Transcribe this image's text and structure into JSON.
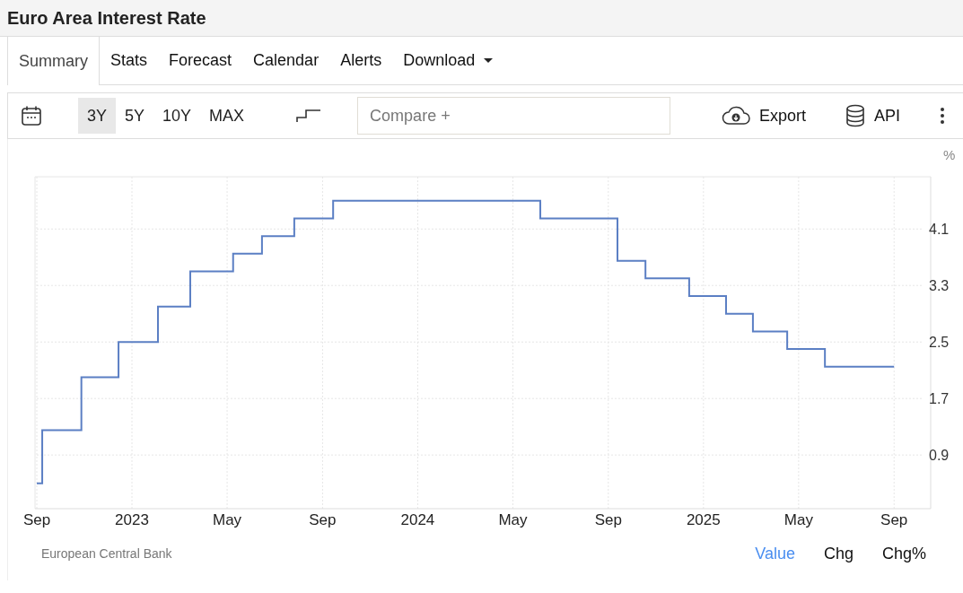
{
  "title": "Euro Area Interest Rate",
  "tabs": [
    {
      "label": "Summary",
      "selected": true,
      "dropdown": false
    },
    {
      "label": "Stats",
      "selected": false,
      "dropdown": false
    },
    {
      "label": "Forecast",
      "selected": false,
      "dropdown": false
    },
    {
      "label": "Calendar",
      "selected": false,
      "dropdown": false
    },
    {
      "label": "Alerts",
      "selected": false,
      "dropdown": false
    },
    {
      "label": "Download",
      "selected": false,
      "dropdown": true
    }
  ],
  "toolbar": {
    "ranges": [
      {
        "label": "3Y",
        "selected": true
      },
      {
        "label": "5Y",
        "selected": false
      },
      {
        "label": "10Y",
        "selected": false
      },
      {
        "label": "MAX",
        "selected": false
      }
    ],
    "compare": {
      "placeholder": "Compare +"
    },
    "export": "Export",
    "api": "API"
  },
  "chart": {
    "unit": "%",
    "chart_data": {
      "type": "line",
      "x": [
        2022.667,
        2022.686,
        2022.686,
        2022.823,
        2022.823,
        2022.953,
        2022.953,
        2023.091,
        2023.091,
        2023.204,
        2023.204,
        2023.354,
        2023.354,
        2023.455,
        2023.455,
        2023.568,
        2023.568,
        2023.704,
        2023.704,
        2024.429,
        2024.429,
        2024.699,
        2024.699,
        2024.797,
        2024.797,
        2024.95,
        2024.95,
        2025.079,
        2025.079,
        2025.173,
        2025.173,
        2025.293,
        2025.293,
        2025.425,
        2025.425,
        2025.667
      ],
      "series": [
        {
          "color": "#5b7fc4",
          "values": [
            0.5,
            0.5,
            1.25,
            1.25,
            2.0,
            2.0,
            2.5,
            2.5,
            3.0,
            3.0,
            3.5,
            3.5,
            3.75,
            3.75,
            4.0,
            4.0,
            4.25,
            4.25,
            4.5,
            4.5,
            4.25,
            4.25,
            3.65,
            3.65,
            3.4,
            3.4,
            3.15,
            3.15,
            2.9,
            2.9,
            2.65,
            2.65,
            2.4,
            2.4,
            2.15,
            2.15
          ]
        }
      ],
      "grid": true,
      "xlim": [
        2022.667,
        2025.77
      ],
      "ylim": [
        0.14,
        4.84
      ],
      "xticks": [
        {
          "value": 2022.667,
          "label": "Sep"
        },
        2023,
        {
          "value": 2023.333,
          "label": "May"
        },
        {
          "value": 2023.667,
          "label": "Sep"
        },
        2024,
        {
          "value": 2024.333,
          "label": "May"
        },
        {
          "value": 2024.667,
          "label": "Sep"
        },
        2025,
        {
          "value": 2025.333,
          "label": "May"
        },
        {
          "value": 2025.667,
          "label": "Sep"
        }
      ],
      "yticks": [
        0.9,
        1.7,
        2.5,
        3.3,
        4.1
      ]
    }
  },
  "source": "European Central Bank",
  "modes": [
    {
      "label": "Value",
      "selected": true
    },
    {
      "label": "Chg",
      "selected": false
    },
    {
      "label": "Chg%",
      "selected": false
    }
  ]
}
